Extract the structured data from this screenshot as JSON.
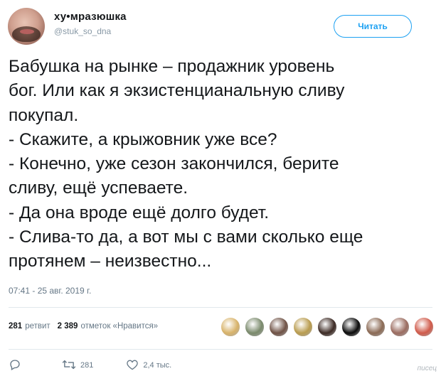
{
  "user": {
    "display_name": "ху•мразюшка",
    "handle": "@stuk_so_dna"
  },
  "follow_button": {
    "label": "Читать",
    "color": "#1da1f2"
  },
  "tweet": {
    "lines": [
      "Бабушка на рынке – продажник уровень",
      "бог. Или как я экзистенцианальную сливу",
      "покупал.",
      "- Скажите, а крыжовник уже все?",
      "- Конечно, уже сезон закончился, берите",
      "сливу, ещё успеваете.",
      "- Да она вроде ещё долго будет.",
      "- Слива-то да, а вот мы с вами сколько еще",
      "протянем – неизвестно..."
    ],
    "timestamp": "07:41 - 25 авг. 2019 г."
  },
  "stats": {
    "retweets_count": "281",
    "retweets_label": "ретвит",
    "likes_count": "2 389",
    "likes_label": "отметок «Нравится»"
  },
  "likers": [
    "#d8b36a",
    "#7a8a6c",
    "#6f5245",
    "#b99c4f",
    "#3d2b25",
    "#0b0b0b",
    "#8b6a55",
    "#9b6c60",
    "#d05a4a"
  ],
  "actions": {
    "reply_icon": "reply-icon",
    "retweet_icon": "retweet-icon",
    "retweet_count": "281",
    "like_icon": "heart-icon",
    "like_count": "2,4 тыс."
  },
  "watermark": "писец"
}
